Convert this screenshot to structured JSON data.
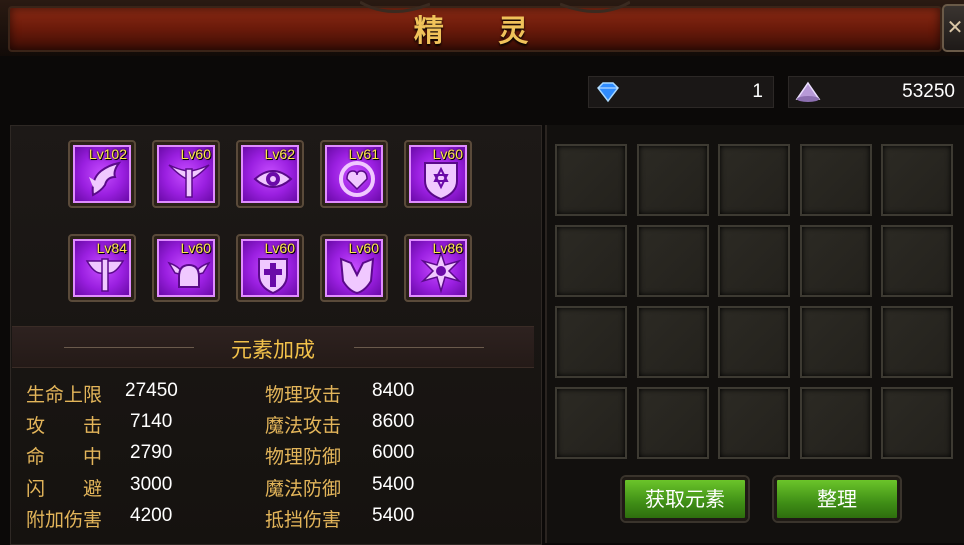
{
  "window": {
    "title": "精 灵"
  },
  "currency": [
    {
      "icon": "blue-diamond-icon",
      "value": "1"
    },
    {
      "icon": "purple-crystal-icon",
      "value": "53250"
    }
  ],
  "spirits": [
    {
      "level": "Lv102",
      "icon": "dragon-crest-icon"
    },
    {
      "level": "Lv60",
      "icon": "winged-sword-icon"
    },
    {
      "level": "Lv62",
      "icon": "eye-icon"
    },
    {
      "level": "Lv61",
      "icon": "heart-crest-icon"
    },
    {
      "level": "Lv60",
      "icon": "star-shield-icon"
    },
    {
      "level": "Lv84",
      "icon": "axe-crest-icon"
    },
    {
      "level": "Lv60",
      "icon": "winged-helm-icon"
    },
    {
      "level": "Lv60",
      "icon": "cross-shield-icon"
    },
    {
      "level": "Lv60",
      "icon": "armor-icon"
    },
    {
      "level": "Lv86",
      "icon": "skull-star-icon"
    }
  ],
  "bonus": {
    "title": "元素加成",
    "left": [
      {
        "label": "生命上限",
        "value": "27450"
      },
      {
        "label": "攻　　击",
        "value": "7140"
      },
      {
        "label": "命　　中",
        "value": "2790"
      },
      {
        "label": "闪　　避",
        "value": "3000"
      },
      {
        "label": "附加伤害",
        "value": "4200"
      }
    ],
    "right": [
      {
        "label": "物理攻击",
        "value": "8400"
      },
      {
        "label": "魔法攻击",
        "value": "8600"
      },
      {
        "label": "物理防御",
        "value": "6000"
      },
      {
        "label": "魔法防御",
        "value": "5400"
      },
      {
        "label": "抵挡伤害",
        "value": "5400"
      }
    ]
  },
  "buttons": {
    "get_elements": "获取元素",
    "organize": "整理"
  },
  "colors": {
    "accent_gold": "#f2c14a",
    "button_green": "#4f9e1a",
    "spirit_purple": "#9a1fe0",
    "level_yellow": "#ffe84a"
  }
}
